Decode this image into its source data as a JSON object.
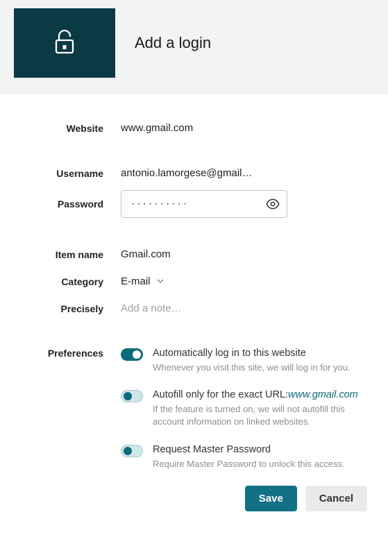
{
  "header": {
    "title": "Add a login",
    "icon": "lock-open-icon"
  },
  "form": {
    "website": {
      "label": "Website",
      "value": "www.gmail.com"
    },
    "username": {
      "label": "Username",
      "value": "antonio.lamorgese@gmail…"
    },
    "password": {
      "label": "Password",
      "masked": "··········"
    },
    "item_name": {
      "label": "Item name",
      "value": "Gmail.com"
    },
    "category": {
      "label": "Category",
      "value": "E-mail"
    },
    "precisely": {
      "label": "Precisely",
      "placeholder": "Add a note…"
    }
  },
  "preferences": {
    "label": "Preferences",
    "items": [
      {
        "title": "Automatically log in to this website",
        "desc": "Whenever you visit this site, we will log in for you.",
        "on": true,
        "style": "dark"
      },
      {
        "title_prefix": "Autofill only for the exact URL:",
        "title_url": "www.gmail.com",
        "desc": "If the feature is turned on, we will not autofill this account information on linked websites.",
        "on": true,
        "style": "light"
      },
      {
        "title": "Request Master Password",
        "desc": "Require Master Password to unlock this access.",
        "on": true,
        "style": "light"
      }
    ]
  },
  "footer": {
    "save": "Save",
    "cancel": "Cancel"
  },
  "colors": {
    "accent_dark": "#0c3a44",
    "accent": "#127085",
    "header_bg": "#f2f3f3"
  }
}
